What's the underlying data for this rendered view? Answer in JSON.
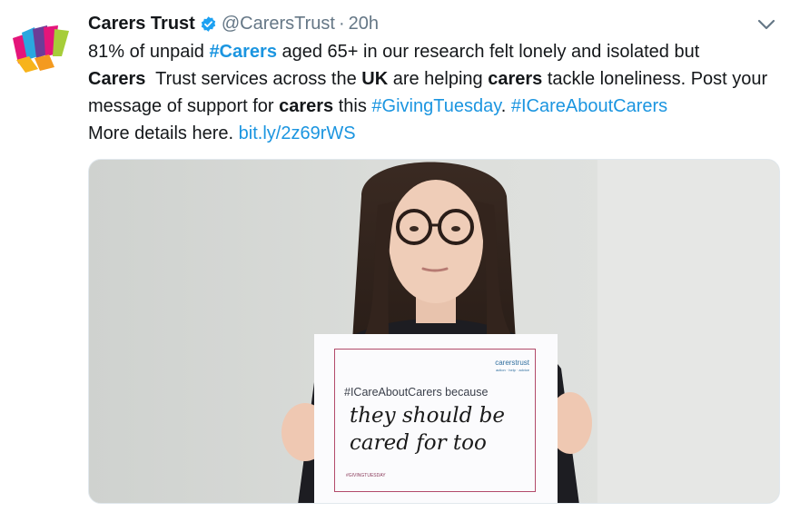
{
  "tweet": {
    "author_name": "Carers Trust",
    "author_handle": "@CarersTrust",
    "separator": "·",
    "timestamp": "20h",
    "icons": {
      "avatar": "carers-trust-logo",
      "verified": "verified-badge-icon",
      "menu": "chevron-down-icon"
    },
    "text": {
      "l1_a": "81% of unpaid ",
      "l1_tag": "#Carers",
      "l1_b": " aged 65+ in our research felt lonely and isolated but",
      "l2_a": "Carers",
      "l2_b": "  Trust services across the ",
      "l2_c": "UK",
      "l2_d": " are helping ",
      "l2_e": "carers",
      "l2_f": " tackle loneliness. Post your",
      "l3_a": "message of support for ",
      "l3_b": "carers",
      "l3_c": " this ",
      "l3_tag1": "#GivingTuesday",
      "l3_d": ". ",
      "l3_tag2": "#ICareAboutCarers",
      "l4_a": "More details here. ",
      "l4_link": "bit.ly/2z69rWS"
    },
    "media": {
      "sign_logo": "carerstrust",
      "sign_logo_sub": "action · help · advice",
      "sign_hashtag": "#ICareAboutCarers because",
      "sign_hand_line1": "they should be",
      "sign_hand_line2": "cared for too",
      "sign_footer": "#GIVINGTUESDAY"
    },
    "colors": {
      "link": "#1b95e0",
      "verified": "#1da1f2",
      "text": "#14171a",
      "muted": "#657786",
      "sign_border": "#b24a6a"
    }
  }
}
